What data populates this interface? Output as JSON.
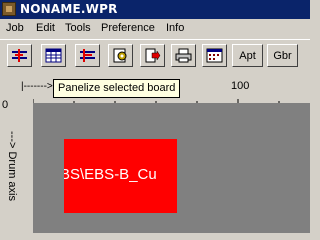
{
  "window": {
    "title": "NONAME.WPR"
  },
  "menu": [
    "Job",
    "Edit",
    "Tools",
    "Preference",
    "Info"
  ],
  "toolbar": {
    "apt_label": "Apt",
    "gbr_label": "Gbr"
  },
  "tooltip": "Panelize selected board",
  "ruler": {
    "x_axis_label": "|------->",
    "x_tick_100": "100",
    "y_tick_0": "0",
    "y_axis_label": "---> Drum axis"
  },
  "board": {
    "label": "BS\\EBS-B_Cu"
  },
  "colors": {
    "titlebar": "#0a246a",
    "board": "#ff0000",
    "canvas": "#808080",
    "tooltip": "#ffffe1"
  }
}
